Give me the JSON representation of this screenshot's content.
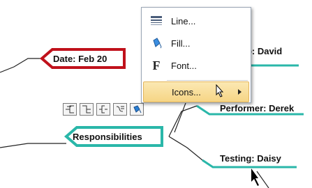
{
  "topics": {
    "date": "Date: Feb 20",
    "group": "up: David",
    "performer": "Performer: Derek",
    "responsibilities": "Responsibilities",
    "testing": "Testing: Daisy"
  },
  "context_menu": {
    "items": [
      {
        "label": "Line...",
        "icon": "line-style-icon"
      },
      {
        "label": "Fill...",
        "icon": "fill-bucket-icon"
      },
      {
        "label": "Font...",
        "icon": "font-icon"
      },
      {
        "label": "Icons...",
        "icon": "submenu-arrow-icon",
        "highlighted": true
      }
    ]
  },
  "toolbar": {
    "buttons": [
      "left-tree-layout-icon",
      "right-tree-layout-icon",
      "bracket-layout-icon",
      "connector-style-icon",
      "fill-format-icon"
    ]
  },
  "colors": {
    "date_topic_border": "#c0111b",
    "topic_border": "#2ab7a9",
    "branch_line": "#222222",
    "menu_highlight": "#f6d585"
  }
}
